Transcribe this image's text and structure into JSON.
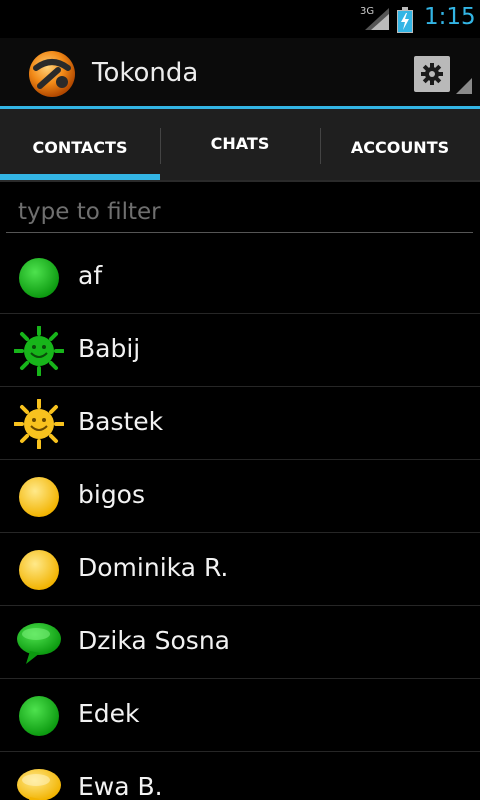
{
  "status_bar": {
    "network": "3G",
    "time": "1:15",
    "accent_color": "#33b5e5"
  },
  "app": {
    "title": "Tokonda",
    "logo_icon": "tokonda-logo-icon",
    "settings_icon": "gear-icon"
  },
  "tabs": [
    {
      "label": "CONTACTS",
      "selected": true
    },
    {
      "label": "CHATS",
      "selected": false
    },
    {
      "label": "ACCOUNTS",
      "selected": false
    }
  ],
  "filter": {
    "placeholder": "type to filter",
    "value": ""
  },
  "contacts": [
    {
      "name": "af",
      "status": "available",
      "icon": "green-dot-icon"
    },
    {
      "name": "Babij",
      "status": "free-for-chat",
      "icon": "green-sun-icon"
    },
    {
      "name": "Bastek",
      "status": "free-for-chat-away",
      "icon": "yellow-sun-icon"
    },
    {
      "name": "bigos",
      "status": "away",
      "icon": "yellow-dot-icon"
    },
    {
      "name": "Dominika R.",
      "status": "away",
      "icon": "yellow-dot-icon"
    },
    {
      "name": "Dzika Sosna",
      "status": "available-chatty",
      "icon": "green-speech-bubble-icon"
    },
    {
      "name": "Edek",
      "status": "available",
      "icon": "green-dot-icon"
    },
    {
      "name": "Ewa B.",
      "status": "away-chatty",
      "icon": "yellow-speech-bubble-icon"
    }
  ],
  "colors": {
    "green": "#17b51a",
    "yellow": "#f8c21e",
    "tab_background": "#1f1f1f"
  }
}
